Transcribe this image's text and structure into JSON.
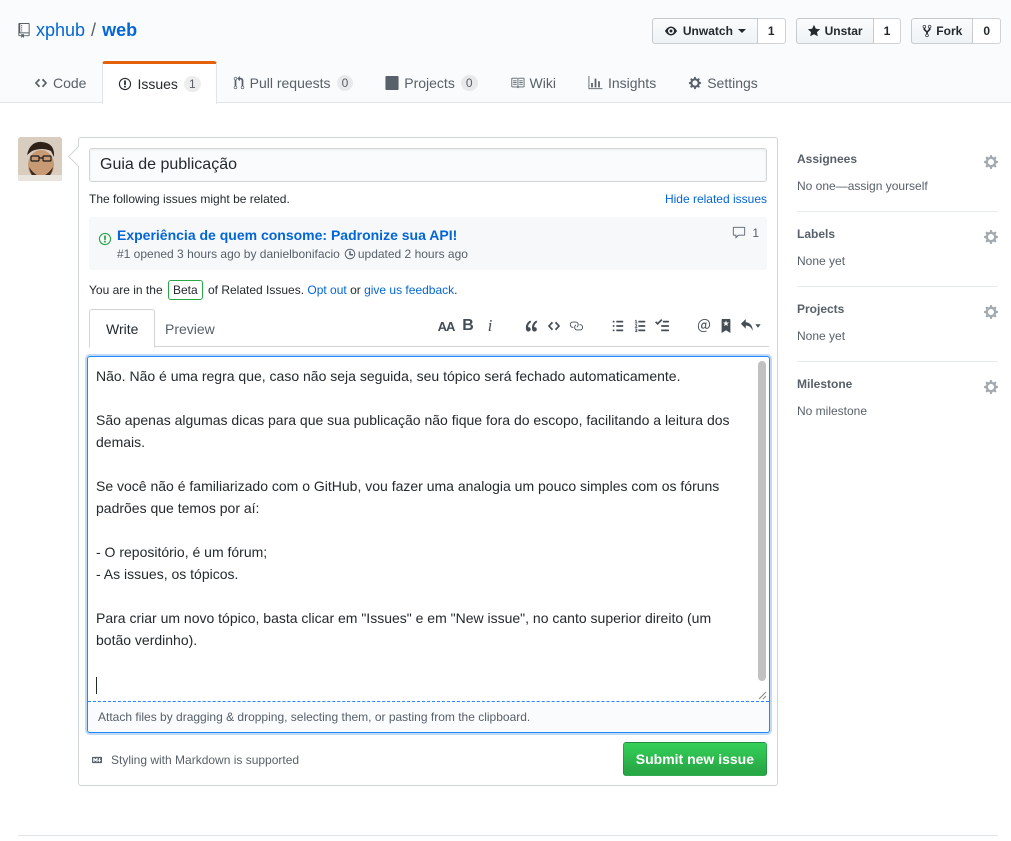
{
  "repo": {
    "owner": "xphub",
    "separator": "/",
    "name": "web"
  },
  "actions": [
    {
      "label": "Unwatch",
      "count": "1",
      "icon": "eye-icon"
    },
    {
      "label": "Unstar",
      "count": "1",
      "icon": "star-icon"
    },
    {
      "label": "Fork",
      "count": "0",
      "icon": "fork-icon"
    }
  ],
  "nav": {
    "code": "Code",
    "issues": "Issues",
    "issues_count": "1",
    "pulls": "Pull requests",
    "pulls_count": "0",
    "projects": "Projects",
    "projects_count": "0",
    "wiki": "Wiki",
    "insights": "Insights",
    "settings": "Settings"
  },
  "form": {
    "title_value": "Guia de publicação",
    "related_text": "The following issues might be related.",
    "hide_related": "Hide related issues",
    "related_issue": {
      "title": "Experiência de quem consome: Padronize sua API!",
      "meta_prefix": "#1 opened 3 hours ago by danielbonifacio",
      "meta_updated": "updated 2 hours ago",
      "comments": "1"
    },
    "beta": {
      "prefix": "You are in the ",
      "badge": "Beta",
      "middle": " of Related Issues. ",
      "opt_out": "Opt out",
      "or": " or ",
      "feedback": "give us feedback",
      "end": "."
    },
    "tabs": {
      "write": "Write",
      "preview": "Preview"
    },
    "body_text": "Não. Não é uma regra que, caso não seja seguida, seu tópico será fechado automaticamente.\n\nSão apenas algumas dicas para que sua publicação não fique fora do escopo, facilitando a leitura dos demais.\n\nSe você não é familiarizado com o GitHub, vou fazer uma analogia um pouco simples com os fóruns padrões que temos por aí:\n\n- O repositório, é um fórum;\n- As issues, os tópicos.\n\nPara criar um novo tópico, basta clicar em \"Issues\" e em \"New issue\", no canto superior direito (um botão verdinho).\n\n",
    "drag_hint": "Attach files by dragging & dropping, selecting them, or pasting from the clipboard.",
    "markdown_note": "Styling with Markdown is supported",
    "submit": "Submit new issue"
  },
  "sidebar": {
    "assignees": {
      "heading": "Assignees",
      "value": "No one—assign yourself"
    },
    "labels": {
      "heading": "Labels",
      "value": "None yet"
    },
    "projects": {
      "heading": "Projects",
      "value": "None yet"
    },
    "milestone": {
      "heading": "Milestone",
      "value": "No milestone"
    }
  },
  "colors": {
    "accent": "#0366d6",
    "issues_tab_top": "#e36209",
    "submit": "#28a745"
  }
}
